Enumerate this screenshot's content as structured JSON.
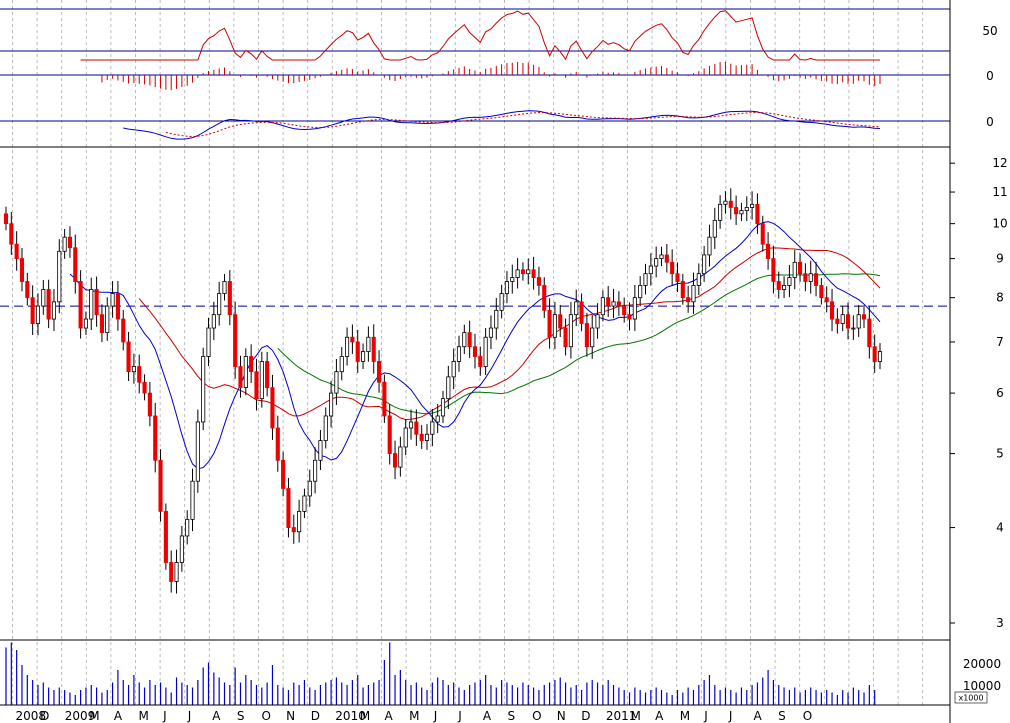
{
  "chart_data": {
    "type": "candlestick",
    "title": "",
    "price_axis": {
      "scale": "log",
      "ylim": [
        2.85,
        12.6
      ],
      "ticks": [
        3,
        4,
        5,
        6,
        7,
        8,
        9,
        10,
        11,
        12
      ]
    },
    "time_axis_labels": [
      "2008",
      "D",
      "2009",
      "M",
      "A",
      "M",
      "J",
      "J",
      "A",
      "S",
      "O",
      "N",
      "D",
      "2010",
      "M",
      "A",
      "M",
      "J",
      "J",
      "A",
      "S",
      "O",
      "N",
      "D",
      "2011",
      "M",
      "A",
      "M",
      "J",
      "J",
      "A",
      "S",
      "O"
    ],
    "reference_level": 7.8,
    "indicator_panels": [
      {
        "name": "oscillator",
        "ticks": [
          "50"
        ],
        "color": "#cc0000"
      },
      {
        "name": "histogram",
        "ticks": [
          "0"
        ],
        "color": "#cc0000"
      },
      {
        "name": "macd",
        "ticks": [
          "0"
        ],
        "colors": [
          "#0000cc",
          "#cc0000"
        ]
      }
    ],
    "volume_axis": {
      "ticks": [
        "20000",
        "10000"
      ],
      "unit": "x1000",
      "ylim": [
        0,
        26000
      ]
    },
    "moving_average_colors": [
      "#0000cc",
      "#cc0000",
      "#007700"
    ],
    "up_color": "#ffffff",
    "down_color": "#ee0000",
    "closes": [
      10.0,
      9.4,
      9.0,
      8.4,
      8.0,
      7.4,
      7.8,
      8.2,
      7.5,
      7.9,
      9.2,
      9.6,
      9.3,
      8.4,
      7.3,
      7.5,
      8.2,
      7.6,
      7.2,
      7.8,
      8.1,
      7.5,
      7.0,
      6.4,
      6.5,
      6.2,
      6.0,
      5.6,
      4.9,
      4.2,
      3.6,
      3.4,
      3.6,
      3.9,
      4.1,
      4.6,
      5.5,
      6.7,
      7.3,
      7.6,
      8.1,
      8.4,
      7.6,
      6.5,
      6.1,
      6.7,
      6.4,
      5.9,
      6.6,
      6.1,
      5.4,
      4.9,
      4.5,
      4.0,
      3.95,
      4.2,
      4.4,
      4.6,
      4.9,
      5.2,
      5.6,
      6.0,
      6.4,
      6.7,
      7.1,
      7.0,
      6.6,
      6.8,
      7.1,
      6.6,
      6.2,
      5.6,
      5.0,
      4.8,
      5.1,
      5.4,
      5.5,
      5.3,
      5.2,
      5.3,
      5.5,
      5.6,
      5.9,
      6.3,
      6.6,
      6.9,
      7.2,
      6.9,
      6.7,
      6.5,
      7.1,
      7.3,
      7.7,
      8.1,
      8.4,
      8.5,
      8.7,
      8.6,
      8.7,
      8.5,
      8.3,
      7.7,
      7.1,
      7.6,
      7.3,
      6.9,
      7.6,
      7.9,
      7.4,
      6.9,
      7.3,
      7.6,
      8.0,
      7.8,
      7.9,
      7.8,
      7.6,
      7.5,
      8.0,
      8.3,
      8.6,
      8.8,
      9.0,
      9.1,
      8.9,
      8.6,
      8.4,
      8.0,
      7.9,
      8.3,
      8.6,
      9.1,
      9.6,
      10.1,
      10.6,
      10.7,
      10.5,
      10.3,
      10.4,
      10.5,
      10.6,
      10.0,
      9.4,
      9.0,
      8.4,
      8.2,
      8.3,
      8.5,
      8.9,
      8.6,
      8.4,
      8.6,
      8.3,
      8.0,
      7.9,
      7.5,
      7.4,
      7.6,
      7.3,
      7.3,
      7.6,
      7.5,
      6.9,
      6.6,
      6.8
    ],
    "volumes": [
      23,
      25,
      22,
      16,
      12,
      10,
      8,
      9,
      7,
      6,
      7,
      6,
      5,
      4,
      6,
      7,
      8,
      7,
      5,
      6,
      9,
      14,
      10,
      8,
      12,
      9,
      7,
      10,
      8,
      9,
      7,
      5,
      11,
      9,
      8,
      7,
      10,
      15,
      17,
      13,
      11,
      9,
      8,
      15,
      9,
      12,
      10,
      8,
      7,
      9,
      16,
      8,
      7,
      6,
      9,
      8,
      10,
      7,
      6,
      8,
      9,
      10,
      11,
      9,
      8,
      10,
      12,
      7,
      8,
      9,
      10,
      18,
      25,
      12,
      14,
      10,
      8,
      9,
      7,
      6,
      9,
      11,
      10,
      8,
      9,
      7,
      6,
      8,
      9,
      10,
      12,
      8,
      7,
      10,
      9,
      8,
      7,
      9,
      8,
      7,
      6,
      8,
      9,
      10,
      11,
      9,
      7,
      8,
      6,
      9,
      10,
      9,
      8,
      10,
      8,
      7,
      6,
      5,
      7,
      6,
      5,
      6,
      7,
      6,
      5,
      4,
      6,
      5,
      7,
      6,
      8,
      10,
      12,
      8,
      6,
      7,
      6,
      5,
      7,
      6,
      8,
      9,
      11,
      14,
      10,
      8,
      7,
      6,
      7,
      5,
      6,
      7,
      6,
      5,
      6,
      5,
      4,
      6,
      5,
      7,
      6,
      5,
      8,
      6
    ]
  }
}
